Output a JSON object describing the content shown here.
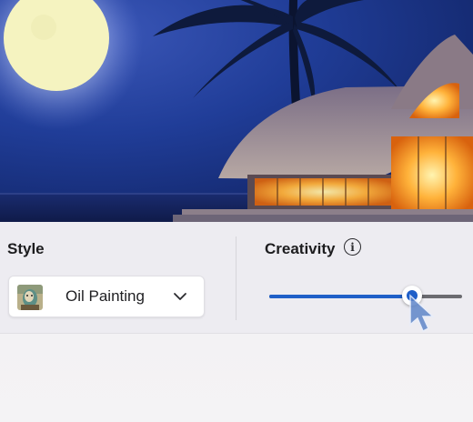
{
  "style": {
    "label": "Style",
    "selected": "Oil Painting",
    "thumbnail_icon": "oil-painting-thumbnail",
    "chevron_icon": "chevron-down-icon"
  },
  "creativity": {
    "label": "Creativity",
    "info_icon": "info-icon",
    "info_glyph": "i",
    "value_fraction": 0.74,
    "accent_color": "#1f5fc8"
  }
}
